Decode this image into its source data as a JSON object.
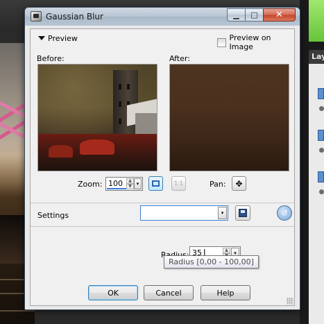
{
  "window": {
    "title": "Gaussian Blur"
  },
  "window_buttons": {
    "minimize": "▁",
    "maximize": "□",
    "close": "✕"
  },
  "preview": {
    "toggle_label": "Preview",
    "preview_on_image_label": "Preview on Image",
    "preview_on_image_checked": false,
    "before_label": "Before:",
    "after_label": "After:",
    "zoom_label": "Zoom:",
    "zoom_value": "100",
    "one_to_one_label": "1:1",
    "pan_label": "Pan:"
  },
  "settings": {
    "label": "Settings",
    "selected_value": ""
  },
  "radius": {
    "label": "Radius:",
    "value": "35",
    "tooltip": "Radius [0,00 - 100,00]"
  },
  "buttons": {
    "ok": "OK",
    "cancel": "Cancel",
    "help": "Help"
  },
  "background": {
    "layers_tab_label": "Lay"
  },
  "icons": {
    "dropdown": "▾",
    "spin_up": "▲",
    "spin_down": "▼",
    "pan": "✥",
    "reset": "↺"
  },
  "colors": {
    "title_bar": "#b8c6d5",
    "close_button": "#c2442b",
    "focus_blue": "#3b7fd0",
    "dialog_bg": "#f0f0f0"
  }
}
